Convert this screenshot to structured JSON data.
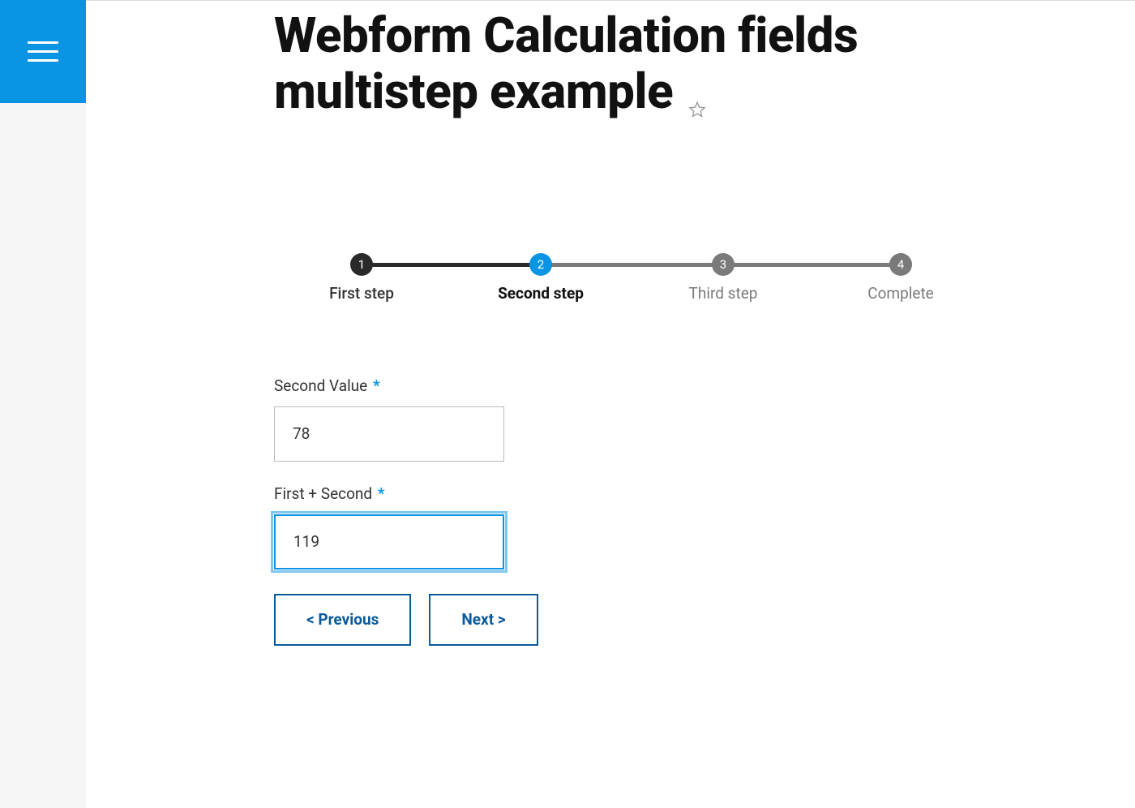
{
  "page_title": "Webform Calculation fields multistep example",
  "progress": {
    "steps": [
      {
        "number": "1",
        "label": "First step",
        "state": "done"
      },
      {
        "number": "2",
        "label": "Second step",
        "state": "active"
      },
      {
        "number": "3",
        "label": "Third step",
        "state": "pending"
      },
      {
        "number": "4",
        "label": "Complete",
        "state": "pending"
      }
    ]
  },
  "form": {
    "fields": [
      {
        "label": "Second Value",
        "required_marker": "*",
        "value": "78",
        "focused": false
      },
      {
        "label": "First + Second",
        "required_marker": "*",
        "value": "119",
        "focused": true
      }
    ]
  },
  "buttons": {
    "previous": "< Previous",
    "next": "Next >"
  }
}
